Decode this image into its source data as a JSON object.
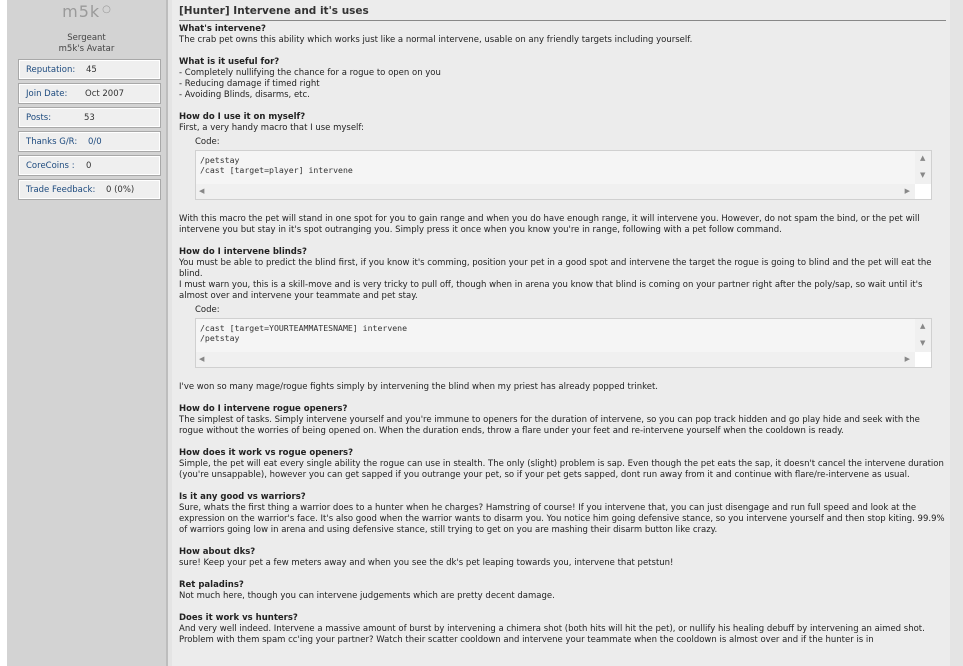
{
  "user": {
    "name": "m5k",
    "rank": "Sergeant",
    "avatar_label": "m5k's Avatar",
    "stats": [
      {
        "label": "Reputation:",
        "value": "45"
      },
      {
        "label": "Join Date:",
        "value": "Oct 2007"
      },
      {
        "label": "Posts:",
        "value": "53"
      },
      {
        "label": "Thanks G/R:",
        "value": "0/0"
      },
      {
        "label": "CoreCoins :",
        "value": "0"
      },
      {
        "label": "Trade Feedback:",
        "value": "0 (0%)"
      }
    ]
  },
  "post": {
    "title": "[Hunter] Intervene and it's uses",
    "q1": "What's intervene?",
    "a1": "The crab pet owns this ability which works just like a normal intervene, usable on any friendly targets including yourself.",
    "q2": "What is it useful for?",
    "a2_1": "- Completely nullifying the chance for a rogue to open on you",
    "a2_2": "- Reducing damage if timed right",
    "a2_3": "- Avoiding Blinds, disarms, etc.",
    "q3": "How do I use it on myself?",
    "a3": "First, a very handy macro that I use myself:",
    "code_label": "Code:",
    "code1": "/petstay\n/cast [target=player] intervene",
    "a3_after": "With this macro the pet will stand in one spot for you to gain range and when you do have enough range, it will intervene you. However, do not spam the bind, or the pet will intervene you but stay in it's spot outranging you. Simply press it once when you know you're in range, following with a pet follow command.",
    "q4": "How do I intervene blinds?",
    "a4_1": "You must be able to predict the blind first, if you know it's comming, position your pet in a good spot and intervene the target the rogue is going to blind and the pet will eat the blind.",
    "a4_2": "I must warn you, this is a skill-move and is very tricky to pull off, though when in arena you know that blind is coming on your partner right after the poly/sap, so wait until it's almost over and intervene your teammate and pet stay.",
    "code2": "/cast [target=YOURTEAMMATESNAME] intervene\n/petstay",
    "a4_after": "I've won so many mage/rogue fights simply by intervening the blind when my priest has already popped trinket.",
    "q5": "How do I intervene rogue openers?",
    "a5": "The simplest of tasks. Simply intervene yourself and you're immune to openers for the duration of intervene, so you can pop track hidden and go play hide and seek with the rogue without the worries of being opened on. When the duration ends, throw a flare under your feet and re-intervene yourself when the cooldown is ready.",
    "q6": "How does it work vs rogue openers?",
    "a6": "Simple, the pet will eat every single ability the rogue can use in stealth. The only (slight) problem is sap. Even though the pet eats the sap, it doesn't cancel the intervene duration (you're unsappable), however you can get sapped if you outrange your pet, so if your pet gets sapped, dont run away from it and continue with flare/re-intervene as usual.",
    "q7": "Is it any good vs warriors?",
    "a7": "Sure, whats the first thing a warrior does to a hunter when he charges? Hamstring of course! If you intervene that, you can just disengage and run full speed and look at the expression on the warrior's face. It's also good when the warrior wants to disarm you. You notice him going defensive stance, so you intervene yourself and then stop kiting. 99.9% of warriors going low in arena and using defensive stance, still trying to get on you are mashing their disarm button like crazy.",
    "q8": "How about dks?",
    "a8": "sure! Keep your pet a few meters away and when you see the dk's pet leaping towards you, intervene that petstun!",
    "q9": "Ret paladins?",
    "a9": "Not much here, though you can intervene judgements which are pretty decent damage.",
    "q10": "Does it work vs hunters?",
    "a10": "And very well indeed. Intervene a massive amount of burst by intervening a chimera shot (both hits will hit the pet), or nullify his healing debuff by intervening an aimed shot. Problem with them spam cc'ing your partner? Watch their scatter cooldown and intervene your teammate when the cooldown is almost over and if the hunter is in"
  }
}
